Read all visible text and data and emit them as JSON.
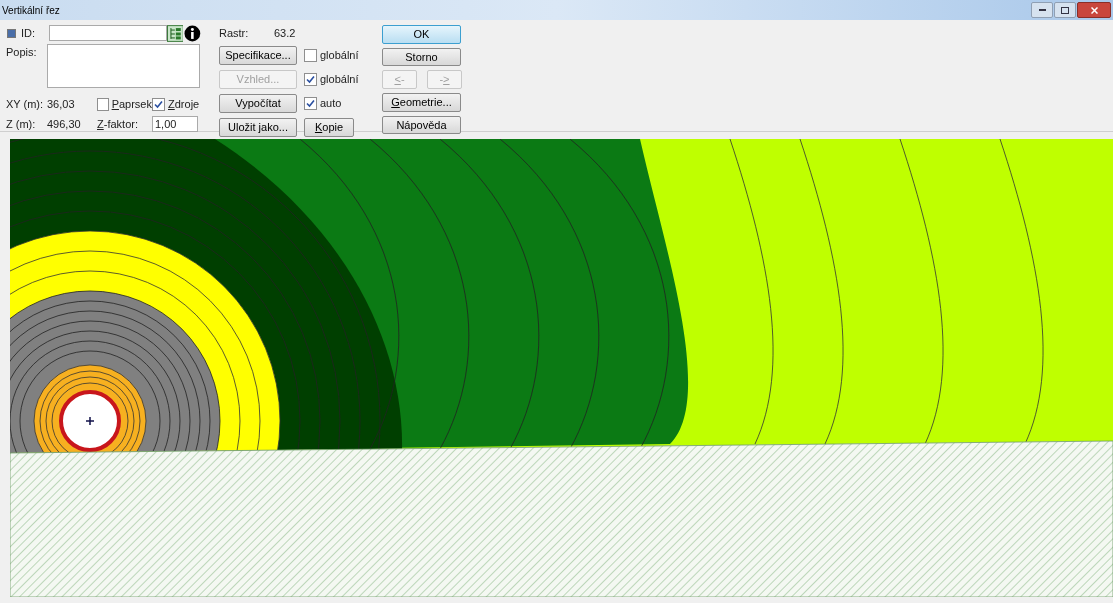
{
  "window": {
    "title": "Vertikální řez"
  },
  "id_row": {
    "checked": true,
    "label": "ID:"
  },
  "popis": {
    "label": "Popis:"
  },
  "xy": {
    "label": "XY (m):",
    "value": "36,03"
  },
  "z": {
    "label": "Z (m):",
    "value": "496,30"
  },
  "paprsek": {
    "label": "Paprsek",
    "checked": false
  },
  "zdroje": {
    "label": "Zdroje",
    "checked": true
  },
  "z_faktor": {
    "label": "Z-faktor:",
    "value": "1,00"
  },
  "rastr": {
    "label": "Rastr:",
    "value": "63.2"
  },
  "middle_rows": [
    {
      "button": {
        "label": "Specifikace...",
        "disabled": false
      },
      "checkbox": {
        "label": "globální",
        "checked": false
      }
    },
    {
      "button": {
        "label": "Vzhled...",
        "disabled": true
      },
      "checkbox": {
        "label": "globální",
        "checked": true
      }
    },
    {
      "button": {
        "label": "Vypočítat",
        "disabled": false
      },
      "checkbox": {
        "label": "auto",
        "checked": true
      }
    },
    {
      "button": {
        "label": "Uložit jako...",
        "disabled": false
      },
      "extra": {
        "label": "Kopie",
        "disabled": false
      }
    }
  ],
  "right_buttons": [
    {
      "kind": "button",
      "label": "OK",
      "default": true,
      "disabled": false
    },
    {
      "kind": "button",
      "label": "Storno",
      "default": false,
      "disabled": false
    },
    {
      "kind": "pair",
      "items": [
        {
          "label": "<-",
          "disabled": true
        },
        {
          "label": "->",
          "disabled": true
        }
      ]
    },
    {
      "kind": "button",
      "label": "Geometrie...",
      "default": false,
      "disabled": false
    },
    {
      "kind": "button",
      "label": "Nápověda",
      "default": false,
      "disabled": false
    }
  ]
}
